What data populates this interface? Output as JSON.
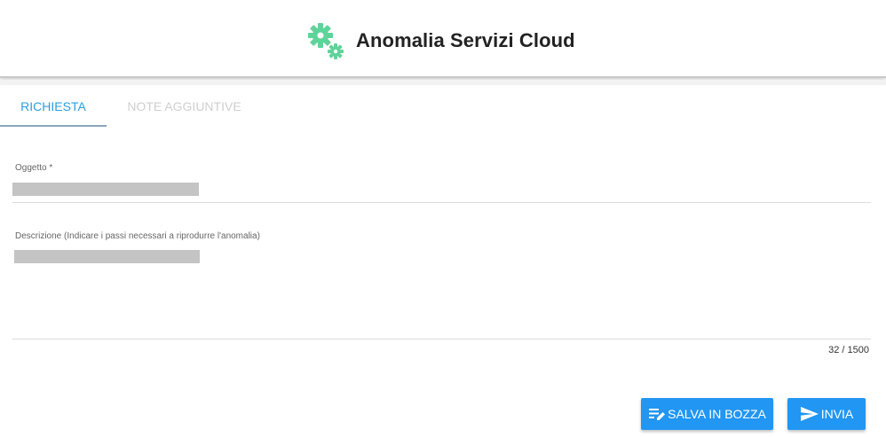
{
  "header": {
    "title": "Anomalia Servizi Cloud",
    "icon": "gears-icon",
    "icon_color": "#5fd39a"
  },
  "tabs": [
    {
      "label": "Richiesta",
      "active": true
    },
    {
      "label": "Note aggiuntive",
      "active": false
    }
  ],
  "form": {
    "subject": {
      "label": "Oggetto *",
      "value": ""
    },
    "description": {
      "label": "Descrizione (Indicare i passi necessari a riprodurre l'anomalia)",
      "value": ""
    },
    "char_counter": "32 / 1500"
  },
  "actions": {
    "save_draft": {
      "label": "Salva in bozza",
      "icon": "edit-notes-icon"
    },
    "send": {
      "label": "Invia",
      "icon": "send-icon"
    }
  },
  "colors": {
    "primary": "#2196f3",
    "tab_active": "#2a9fe0",
    "accent_icon": "#5fd39a"
  }
}
